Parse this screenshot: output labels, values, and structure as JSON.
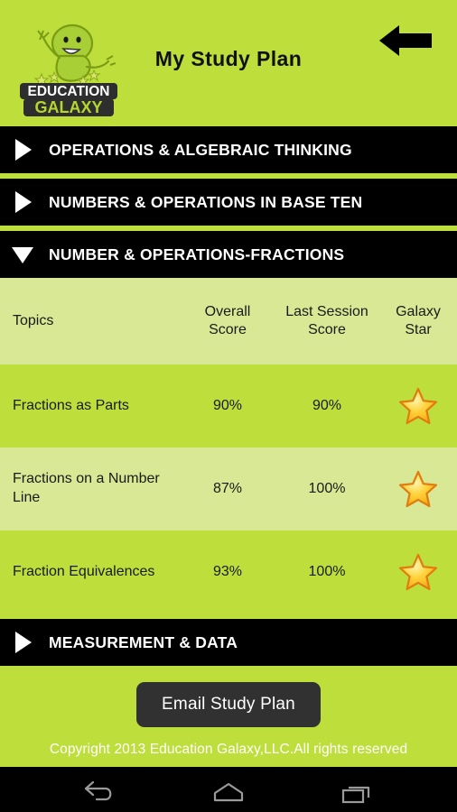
{
  "header": {
    "title": "My Study Plan",
    "logo": {
      "line1": "EDUCATION",
      "line2": "GALAXY",
      "alt": "education-galaxy-alien-mascot-logo"
    },
    "back_icon": "back-arrow-icon"
  },
  "sections": [
    {
      "id": "operations-algebraic-thinking",
      "label": "OPERATIONS & ALGEBRAIC THINKING",
      "expanded": false,
      "icon": "triangle-right-icon"
    },
    {
      "id": "numbers-operations-base-ten",
      "label": "NUMBERS & OPERATIONS IN BASE TEN",
      "expanded": false,
      "icon": "triangle-right-icon"
    },
    {
      "id": "number-operations-fractions",
      "label": "NUMBER & OPERATIONS-FRACTIONS",
      "expanded": true,
      "icon": "triangle-down-icon"
    },
    {
      "id": "measurement-data",
      "label": "MEASUREMENT & DATA",
      "expanded": false,
      "icon": "triangle-right-icon"
    }
  ],
  "table": {
    "columns": [
      {
        "key": "topic",
        "label": "Topics"
      },
      {
        "key": "overall",
        "label": "Overall\nScore",
        "line1": "Overall",
        "line2": "Score"
      },
      {
        "key": "last",
        "label": "Last Session\nScore",
        "line1": "Last Session",
        "line2": "Score"
      },
      {
        "key": "star",
        "label": "Galaxy\nStar",
        "line1": "Galaxy",
        "line2": "Star"
      }
    ],
    "rows": [
      {
        "topic": "Fractions as Parts",
        "overall": "90%",
        "last": "90%",
        "star": true,
        "star_icon": "gold-star-icon"
      },
      {
        "topic": "Fractions on a Number Line",
        "overall": "87%",
        "last": "100%",
        "star": true,
        "star_icon": "gold-star-icon"
      },
      {
        "topic": "Fraction Equivalences",
        "overall": "93%",
        "last": "100%",
        "star": true,
        "star_icon": "gold-star-icon"
      }
    ]
  },
  "actions": {
    "email_study_plan": "Email Study Plan"
  },
  "footer": {
    "copyright": "Copyright 2013 Education Galaxy,LLC.All rights reserved"
  },
  "navbar": {
    "back": "android-back-icon",
    "home": "android-home-icon",
    "recents": "android-recents-icon"
  },
  "colors": {
    "brand_green": "#bede3c",
    "light_green": "#d8e894",
    "header_black": "#000000",
    "button_dark": "#313131",
    "star_gold": "#ffd23a",
    "star_orange": "#f08a15",
    "text_white": "#ffffff",
    "text_black": "#1a1a1a"
  }
}
